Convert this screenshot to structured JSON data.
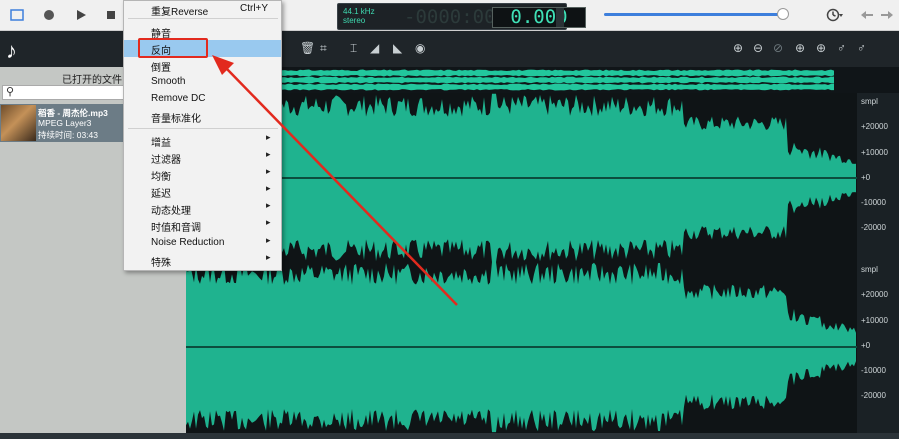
{
  "lcd": {
    "rate": "44.1 kHz",
    "channels": "stereo",
    "ghost_digits": "-0000:00:00",
    "time": "0.000"
  },
  "file_panel": {
    "title": "已打开的文件"
  },
  "file": {
    "name": "稻香 - 周杰伦.mp3",
    "format": "MPEG Layer3",
    "duration": "持续时间: 03:43"
  },
  "menu": {
    "items": [
      {
        "label": "重复Reverse",
        "shortcut": "Ctrl+Y"
      },
      {
        "label": "静音"
      },
      {
        "label": "反向",
        "highlighted": true
      },
      {
        "label": "倒置"
      },
      {
        "label": "Smooth"
      },
      {
        "label": "Remove DC"
      },
      {
        "label": "音量标准化"
      },
      {
        "label": "增益",
        "submenu": true
      },
      {
        "label": "过滤器",
        "submenu": true
      },
      {
        "label": "均衡",
        "submenu": true
      },
      {
        "label": "延迟",
        "submenu": true
      },
      {
        "label": "动态处理",
        "submenu": true
      },
      {
        "label": "时值和音调",
        "submenu": true
      },
      {
        "label": "Noise Reduction",
        "submenu": true
      },
      {
        "label": "特殊",
        "submenu": true
      }
    ],
    "submenu_arrow": "▸"
  },
  "ruler": {
    "unit": "smpl",
    "ticks": [
      "+20000",
      "+10000",
      "+0",
      "-10000",
      "-20000"
    ]
  },
  "colors": {
    "waveform": "#1fb38f",
    "overview": "#22c79d",
    "highlight_box": "#e22a1e",
    "arrow": "#e22a1e"
  },
  "icons": {
    "toolbar": [
      "record-icon",
      "play-icon",
      "stop-icon",
      "history-icon",
      "back-icon",
      "forward-icon"
    ],
    "editor": [
      "delete-icon",
      "crop-icon",
      "zoom-in-icon",
      "zoom-out-icon",
      "zoom-fit-icon"
    ]
  }
}
